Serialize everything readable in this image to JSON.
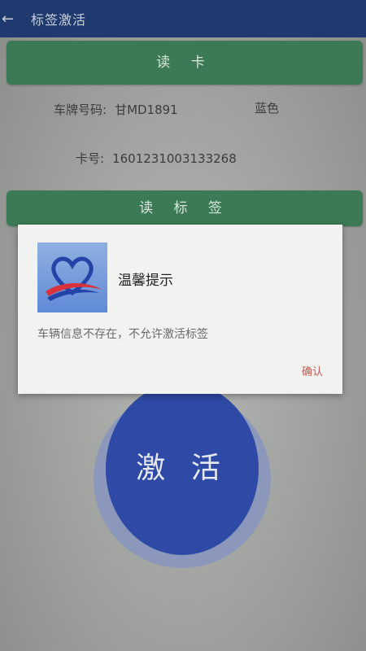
{
  "appbar": {
    "back_icon": "arrow-left-icon",
    "title": "标签激活"
  },
  "read_card": {
    "label": "读 卡"
  },
  "vehicle": {
    "plate_label": "车牌号码:",
    "plate_value": "甘MD1891",
    "plate_color": "蓝色",
    "card_label": "卡号:",
    "card_value": "1601231003133268"
  },
  "read_tag": {
    "label": "读 标 签"
  },
  "activate": {
    "label": "激 活"
  },
  "dialog": {
    "logo_icon": "app-logo-icon",
    "title": "温馨提示",
    "message": "车辆信息不存在，不允许激活标签",
    "confirm_label": "确认"
  },
  "colors": {
    "appbar": "#1f3a6e",
    "green_button": "#3b7a55",
    "activate_button": "#2e4aa6",
    "confirm_text": "#c2564c"
  }
}
